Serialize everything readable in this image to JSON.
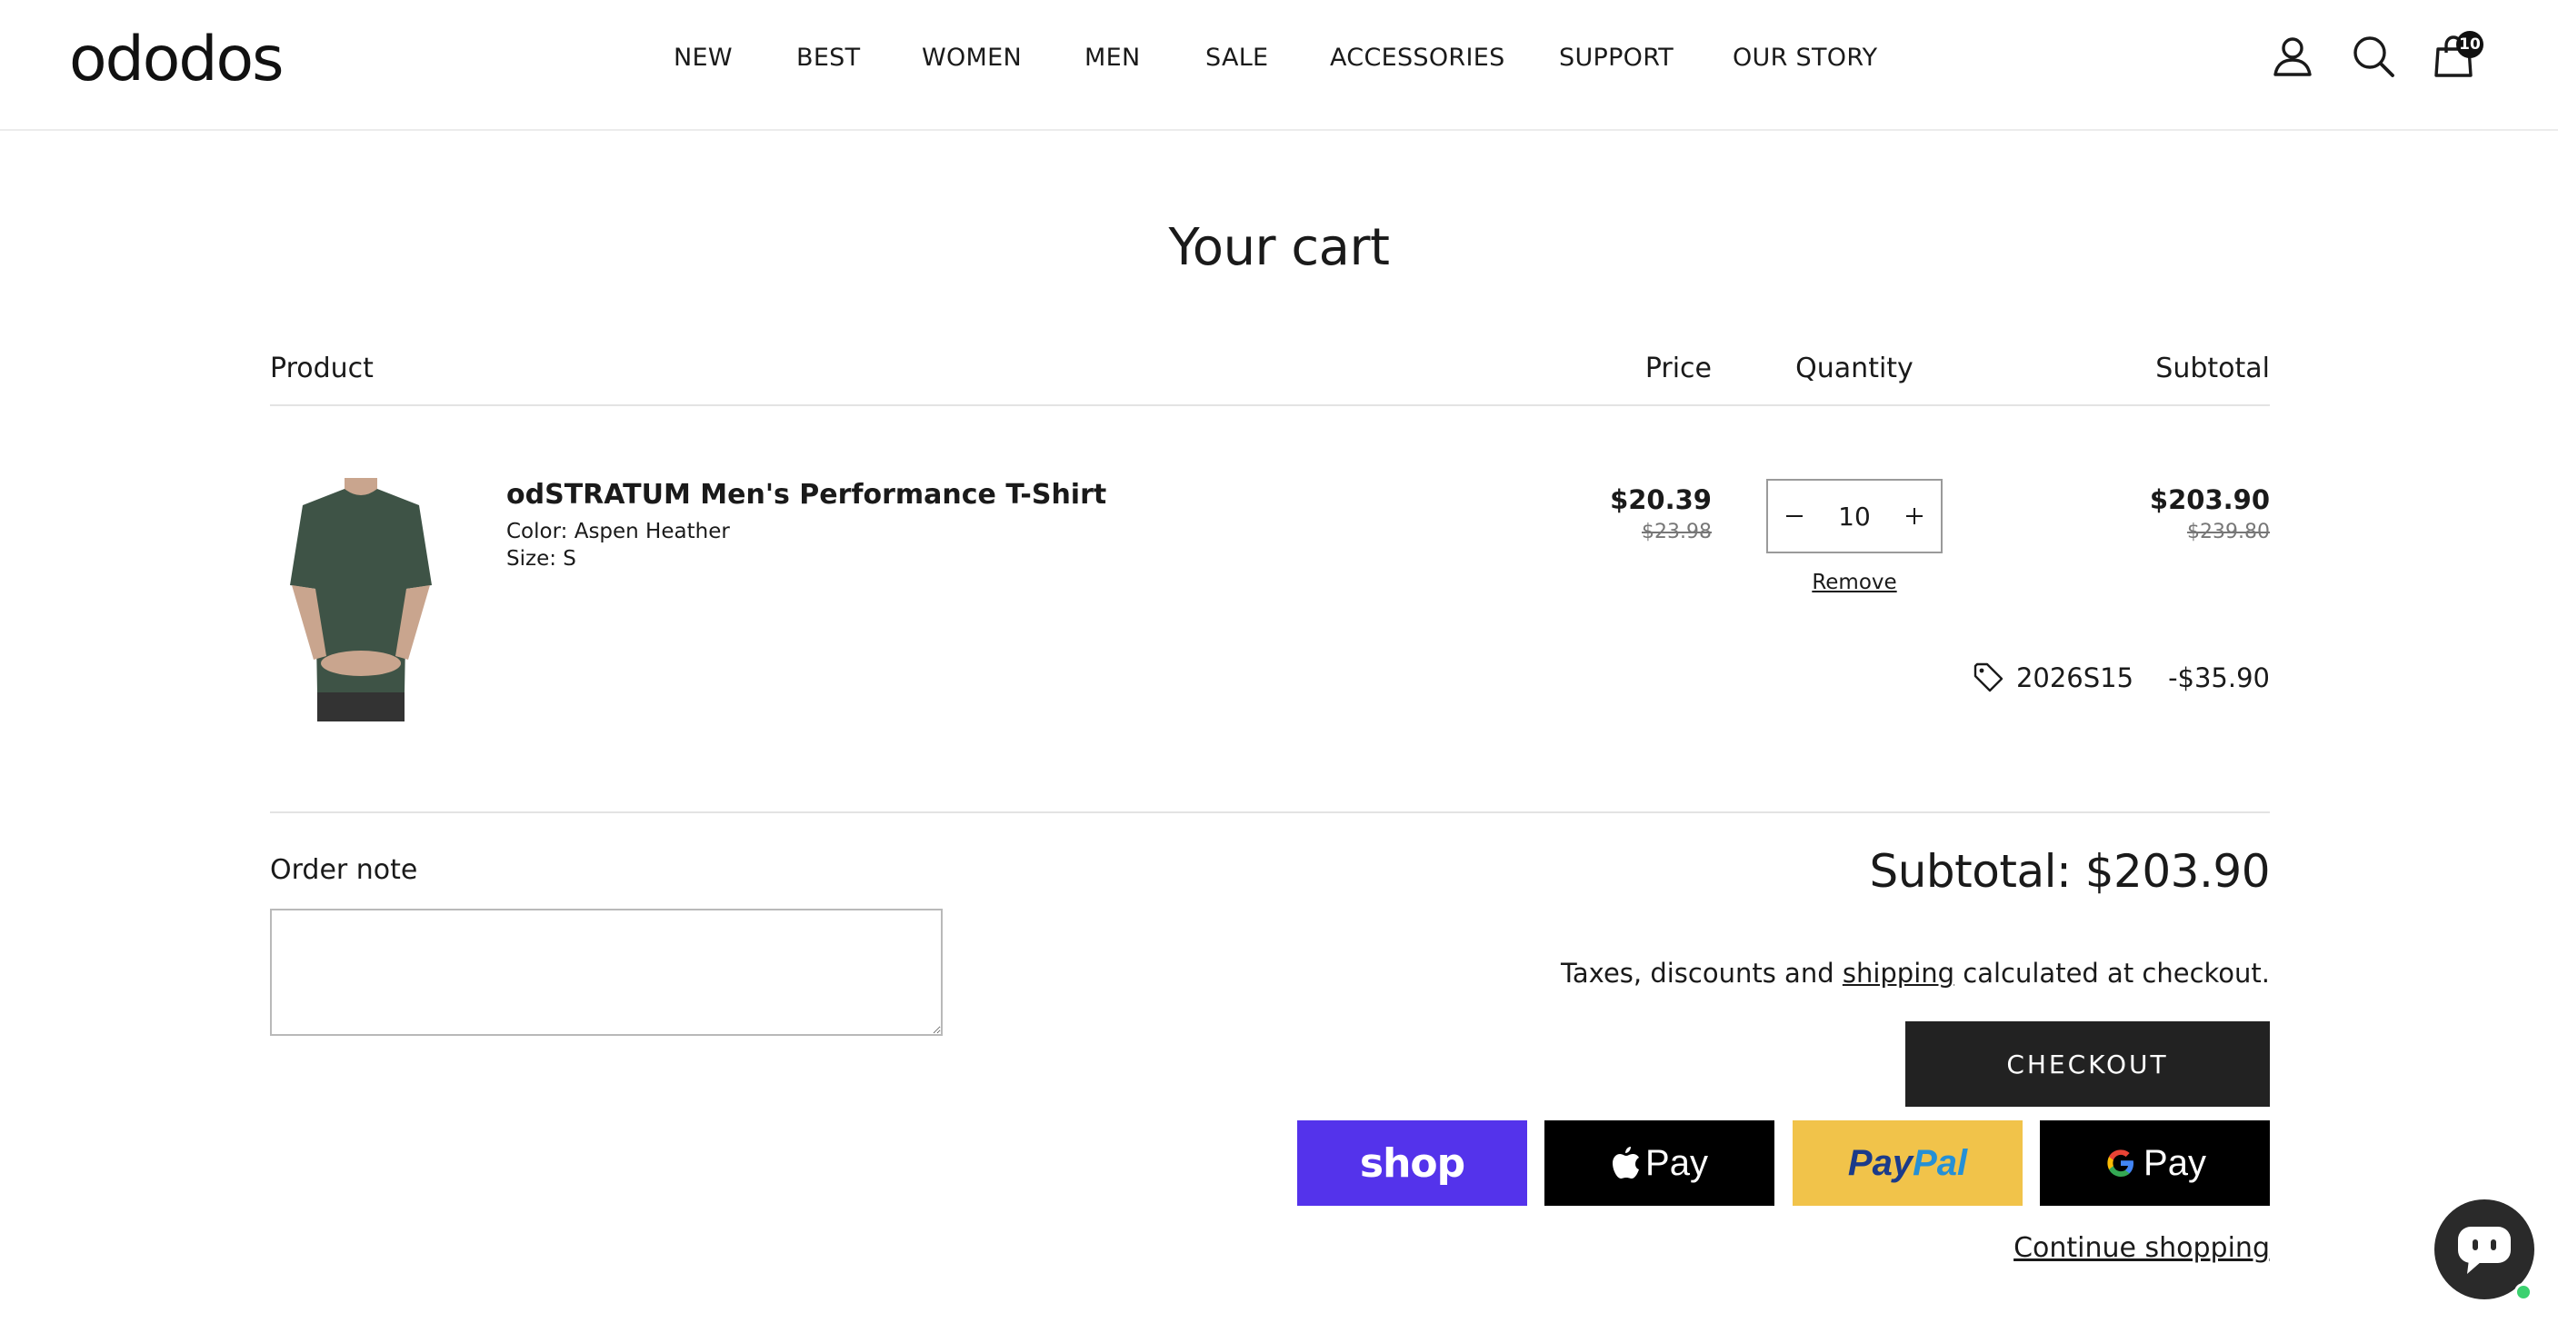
{
  "brand": {
    "logo": "ododos"
  },
  "nav": {
    "items": [
      {
        "label": "NEW"
      },
      {
        "label": "BEST"
      },
      {
        "label": "WOMEN"
      },
      {
        "label": "MEN"
      },
      {
        "label": "SALE"
      },
      {
        "label": "ACCESSORIES"
      },
      {
        "label": "SUPPORT"
      },
      {
        "label": "OUR STORY"
      }
    ]
  },
  "header_icons": {
    "account": "account-icon",
    "search": "search-icon",
    "cart": "cart-icon",
    "cart_count": "10"
  },
  "cart": {
    "title": "Your cart",
    "columns": {
      "product": "Product",
      "price": "Price",
      "quantity": "Quantity",
      "subtotal": "Subtotal"
    },
    "items": [
      {
        "name": "odSTRATUM Men's Performance T-Shirt",
        "color": "Color: Aspen Heather",
        "size": "Size: S",
        "price": "$20.39",
        "price_original": "$23.98",
        "quantity": "10",
        "remove_label": "Remove",
        "subtotal": "$203.90",
        "subtotal_original": "$239.80",
        "discount_code": "2026S15",
        "discount_amount": "-$35.90",
        "shirt_color": "#3e5346"
      }
    ],
    "order_note_label": "Order note",
    "total_label": "Subtotal: $203.90",
    "taxes": {
      "before": "Taxes, discounts and ",
      "link": "shipping",
      "after": " calculated at checkout."
    },
    "checkout_label": "CHECKOUT",
    "payments": {
      "shop": "shop",
      "apple": "Pay",
      "paypal_1": "Pay",
      "paypal_2": "Pal",
      "google": "Pay"
    },
    "continue_label": "Continue shopping"
  },
  "colors": {
    "checkout_bg": "#222222",
    "shop_pay": "#5433eb",
    "paypal": "#f1c34a",
    "chat_online": "#3bd16f"
  }
}
